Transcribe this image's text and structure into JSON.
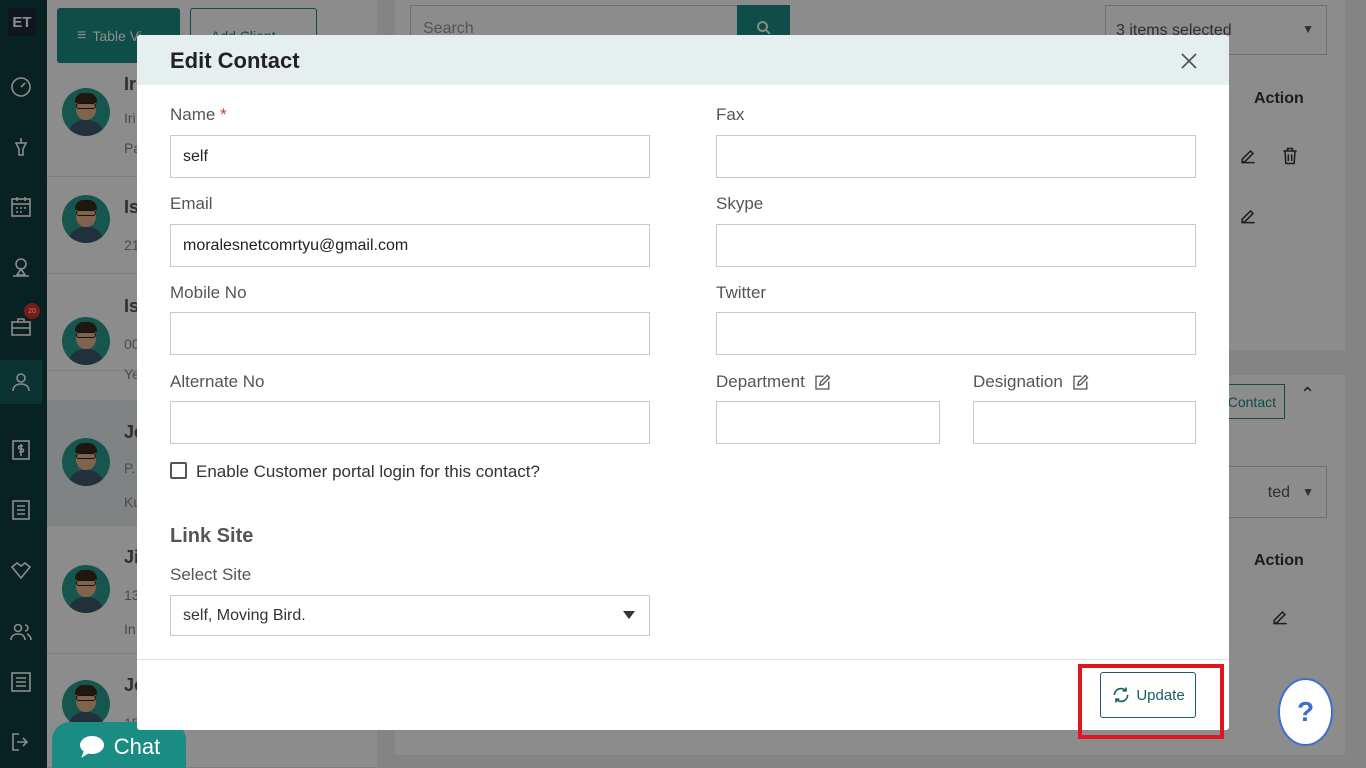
{
  "sidebar": {
    "logo": "ET",
    "badge": "20",
    "items": [
      "dashboard-icon",
      "funnel-icon",
      "calendar-icon",
      "map-pin-icon",
      "briefcase-icon",
      "user-icon",
      "dollar-icon",
      "list-icon",
      "handshake-icon",
      "users-icon",
      "sliders-icon",
      "logout-icon"
    ]
  },
  "background": {
    "table_view_label": "Table Vi",
    "add_client_label": "Add Client",
    "search_placeholder": "Search",
    "items_selected": "3 items selected",
    "items_selected_2": "ted",
    "action_header": "Action",
    "action_header_2": "Action",
    "contact_btn": "Contact",
    "contacts": [
      {
        "letter": "Ir",
        "line1": "Iri",
        "line2": "Pa"
      },
      {
        "letter": "Is",
        "line1": "21",
        "line2": ""
      },
      {
        "letter": "Is",
        "line1": "00",
        "line2": "Ye"
      },
      {
        "letter": "Je",
        "line1": "P.",
        "line2": "Ku"
      },
      {
        "letter": "Ji",
        "line1": "13",
        "line2": "In"
      },
      {
        "letter": "Jo",
        "line1": "15",
        "line2": ""
      }
    ]
  },
  "chat": {
    "label": "Chat"
  },
  "help": {
    "label": "?"
  },
  "modal": {
    "title": "Edit Contact",
    "fields": {
      "name": {
        "label": "Name",
        "required": "*",
        "value": "self"
      },
      "email": {
        "label": "Email",
        "value": "moralesnetcomrtyu@gmail.com"
      },
      "mobile": {
        "label": "Mobile No",
        "value": ""
      },
      "alternate": {
        "label": "Alternate No",
        "value": ""
      },
      "fax": {
        "label": "Fax",
        "value": ""
      },
      "skype": {
        "label": "Skype",
        "value": ""
      },
      "twitter": {
        "label": "Twitter",
        "value": ""
      },
      "department": {
        "label": "Department",
        "value": ""
      },
      "designation": {
        "label": "Designation",
        "value": ""
      }
    },
    "portal_checkbox_label": "Enable Customer portal login for this contact?",
    "link_site_title": "Link Site",
    "select_site_label": "Select Site",
    "select_site_value": "self, Moving Bird.",
    "update_label": "Update"
  },
  "colors": {
    "accent": "#1a8c84",
    "sidebar": "#0d3f3c",
    "highlight": "#e0161e"
  }
}
